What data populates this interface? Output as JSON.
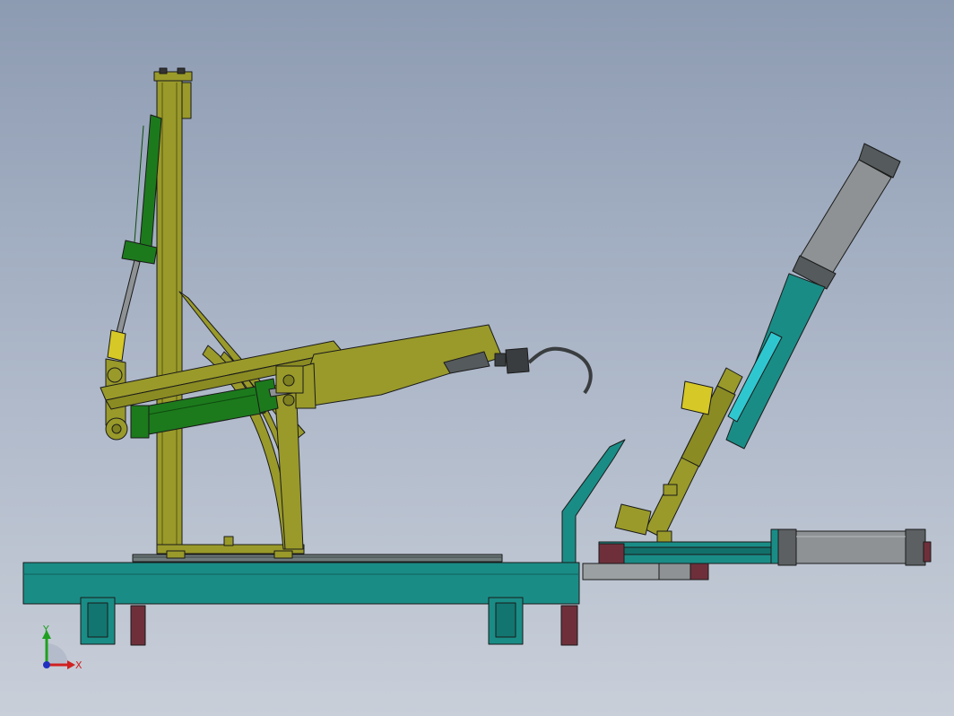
{
  "triad": {
    "x_label": "X",
    "y_label": "Y"
  },
  "colors": {
    "frame_olive": "#999a2a",
    "base_teal": "#1a8c86",
    "cylinder_green": "#1c7a1c",
    "cylinder_gray": "#8e9294",
    "feet_maroon": "#6e2f3b",
    "axis_x": "#d02020",
    "axis_y": "#20a020",
    "axis_z": "#2030c0"
  }
}
